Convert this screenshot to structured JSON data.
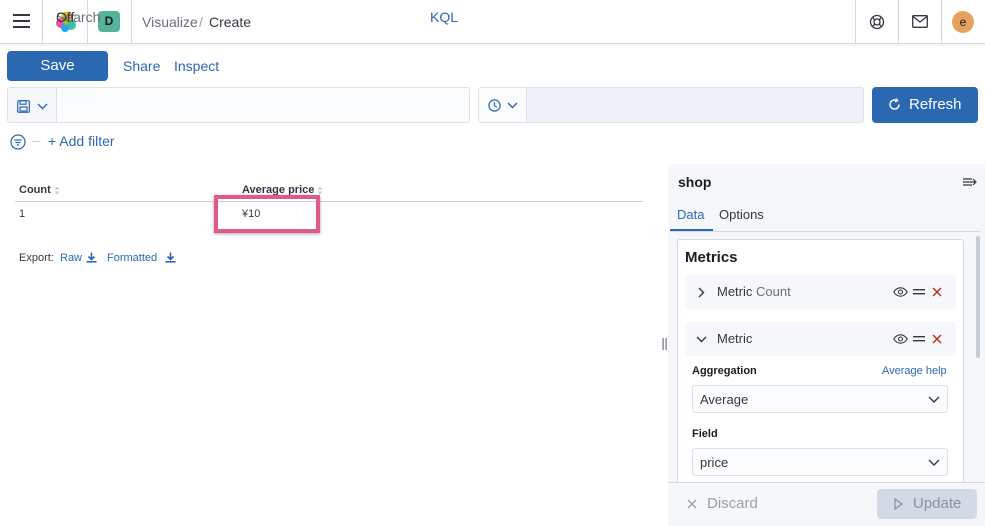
{
  "header": {
    "space_initial": "D",
    "breadcrumbs": [
      "Visualize",
      "Create"
    ],
    "breadcrumb_separator": "/",
    "user_initial": "e"
  },
  "top_nav": {
    "save_label": "Save",
    "share_label": "Share",
    "inspect_label": "Inspect"
  },
  "query_bar": {
    "search_placeholder": "Search",
    "language_label": "KQL",
    "refresh_interval": "Off",
    "refresh_label": "Refresh"
  },
  "filter_bar": {
    "add_filter_label": "+ Add filter"
  },
  "table": {
    "columns": [
      "Count",
      "Average price"
    ],
    "rows": [
      [
        "1",
        "¥10"
      ]
    ],
    "export_label": "Export:",
    "export_raw": "Raw",
    "export_formatted": "Formatted"
  },
  "sidebar": {
    "index_pattern": "shop",
    "tabs": [
      "Data",
      "Options"
    ],
    "metrics_heading": "Metrics",
    "metrics": [
      {
        "label": "Metric",
        "detail": "Count",
        "expanded": false
      },
      {
        "label": "Metric",
        "detail": "",
        "expanded": true
      }
    ],
    "aggregation_label": "Aggregation",
    "aggregation_help": "Average help",
    "aggregation_value": "Average",
    "field_label": "Field",
    "field_value": "price",
    "discard_label": "Discard",
    "update_label": "Update"
  },
  "colors": {
    "primary": "#2a68b1",
    "highlight": "#e0598b",
    "space_badge": "#54b399",
    "avatar": "#e7a15e",
    "danger": "#bd271e"
  }
}
